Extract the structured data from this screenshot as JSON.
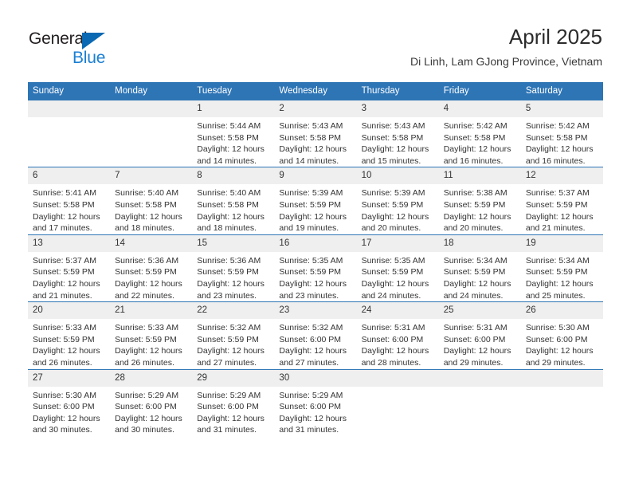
{
  "logo": {
    "word1": "General",
    "word2": "Blue",
    "triangle_color": "#0a69b2",
    "blue_text_color": "#1a7fd4"
  },
  "header": {
    "title": "April 2025",
    "subtitle": "Di Linh, Lam GJong Province, Vietnam"
  },
  "theme": {
    "header_blue": "#2e75b6",
    "daynum_bg": "#efefef",
    "text": "#333333"
  },
  "weekday_headers": [
    "Sunday",
    "Monday",
    "Tuesday",
    "Wednesday",
    "Thursday",
    "Friday",
    "Saturday"
  ],
  "labels": {
    "sunrise": "Sunrise:",
    "sunset": "Sunset:",
    "daylight": "Daylight:"
  },
  "weeks": [
    [
      {
        "day": "",
        "empty": true
      },
      {
        "day": "",
        "empty": true
      },
      {
        "day": "1",
        "sunrise": "Sunrise: 5:44 AM",
        "sunset": "Sunset: 5:58 PM",
        "daylight": "Daylight: 12 hours and 14 minutes."
      },
      {
        "day": "2",
        "sunrise": "Sunrise: 5:43 AM",
        "sunset": "Sunset: 5:58 PM",
        "daylight": "Daylight: 12 hours and 14 minutes."
      },
      {
        "day": "3",
        "sunrise": "Sunrise: 5:43 AM",
        "sunset": "Sunset: 5:58 PM",
        "daylight": "Daylight: 12 hours and 15 minutes."
      },
      {
        "day": "4",
        "sunrise": "Sunrise: 5:42 AM",
        "sunset": "Sunset: 5:58 PM",
        "daylight": "Daylight: 12 hours and 16 minutes."
      },
      {
        "day": "5",
        "sunrise": "Sunrise: 5:42 AM",
        "sunset": "Sunset: 5:58 PM",
        "daylight": "Daylight: 12 hours and 16 minutes."
      }
    ],
    [
      {
        "day": "6",
        "sunrise": "Sunrise: 5:41 AM",
        "sunset": "Sunset: 5:58 PM",
        "daylight": "Daylight: 12 hours and 17 minutes."
      },
      {
        "day": "7",
        "sunrise": "Sunrise: 5:40 AM",
        "sunset": "Sunset: 5:58 PM",
        "daylight": "Daylight: 12 hours and 18 minutes."
      },
      {
        "day": "8",
        "sunrise": "Sunrise: 5:40 AM",
        "sunset": "Sunset: 5:58 PM",
        "daylight": "Daylight: 12 hours and 18 minutes."
      },
      {
        "day": "9",
        "sunrise": "Sunrise: 5:39 AM",
        "sunset": "Sunset: 5:59 PM",
        "daylight": "Daylight: 12 hours and 19 minutes."
      },
      {
        "day": "10",
        "sunrise": "Sunrise: 5:39 AM",
        "sunset": "Sunset: 5:59 PM",
        "daylight": "Daylight: 12 hours and 20 minutes."
      },
      {
        "day": "11",
        "sunrise": "Sunrise: 5:38 AM",
        "sunset": "Sunset: 5:59 PM",
        "daylight": "Daylight: 12 hours and 20 minutes."
      },
      {
        "day": "12",
        "sunrise": "Sunrise: 5:37 AM",
        "sunset": "Sunset: 5:59 PM",
        "daylight": "Daylight: 12 hours and 21 minutes."
      }
    ],
    [
      {
        "day": "13",
        "sunrise": "Sunrise: 5:37 AM",
        "sunset": "Sunset: 5:59 PM",
        "daylight": "Daylight: 12 hours and 21 minutes."
      },
      {
        "day": "14",
        "sunrise": "Sunrise: 5:36 AM",
        "sunset": "Sunset: 5:59 PM",
        "daylight": "Daylight: 12 hours and 22 minutes."
      },
      {
        "day": "15",
        "sunrise": "Sunrise: 5:36 AM",
        "sunset": "Sunset: 5:59 PM",
        "daylight": "Daylight: 12 hours and 23 minutes."
      },
      {
        "day": "16",
        "sunrise": "Sunrise: 5:35 AM",
        "sunset": "Sunset: 5:59 PM",
        "daylight": "Daylight: 12 hours and 23 minutes."
      },
      {
        "day": "17",
        "sunrise": "Sunrise: 5:35 AM",
        "sunset": "Sunset: 5:59 PM",
        "daylight": "Daylight: 12 hours and 24 minutes."
      },
      {
        "day": "18",
        "sunrise": "Sunrise: 5:34 AM",
        "sunset": "Sunset: 5:59 PM",
        "daylight": "Daylight: 12 hours and 24 minutes."
      },
      {
        "day": "19",
        "sunrise": "Sunrise: 5:34 AM",
        "sunset": "Sunset: 5:59 PM",
        "daylight": "Daylight: 12 hours and 25 minutes."
      }
    ],
    [
      {
        "day": "20",
        "sunrise": "Sunrise: 5:33 AM",
        "sunset": "Sunset: 5:59 PM",
        "daylight": "Daylight: 12 hours and 26 minutes."
      },
      {
        "day": "21",
        "sunrise": "Sunrise: 5:33 AM",
        "sunset": "Sunset: 5:59 PM",
        "daylight": "Daylight: 12 hours and 26 minutes."
      },
      {
        "day": "22",
        "sunrise": "Sunrise: 5:32 AM",
        "sunset": "Sunset: 5:59 PM",
        "daylight": "Daylight: 12 hours and 27 minutes."
      },
      {
        "day": "23",
        "sunrise": "Sunrise: 5:32 AM",
        "sunset": "Sunset: 6:00 PM",
        "daylight": "Daylight: 12 hours and 27 minutes."
      },
      {
        "day": "24",
        "sunrise": "Sunrise: 5:31 AM",
        "sunset": "Sunset: 6:00 PM",
        "daylight": "Daylight: 12 hours and 28 minutes."
      },
      {
        "day": "25",
        "sunrise": "Sunrise: 5:31 AM",
        "sunset": "Sunset: 6:00 PM",
        "daylight": "Daylight: 12 hours and 29 minutes."
      },
      {
        "day": "26",
        "sunrise": "Sunrise: 5:30 AM",
        "sunset": "Sunset: 6:00 PM",
        "daylight": "Daylight: 12 hours and 29 minutes."
      }
    ],
    [
      {
        "day": "27",
        "sunrise": "Sunrise: 5:30 AM",
        "sunset": "Sunset: 6:00 PM",
        "daylight": "Daylight: 12 hours and 30 minutes."
      },
      {
        "day": "28",
        "sunrise": "Sunrise: 5:29 AM",
        "sunset": "Sunset: 6:00 PM",
        "daylight": "Daylight: 12 hours and 30 minutes."
      },
      {
        "day": "29",
        "sunrise": "Sunrise: 5:29 AM",
        "sunset": "Sunset: 6:00 PM",
        "daylight": "Daylight: 12 hours and 31 minutes."
      },
      {
        "day": "30",
        "sunrise": "Sunrise: 5:29 AM",
        "sunset": "Sunset: 6:00 PM",
        "daylight": "Daylight: 12 hours and 31 minutes."
      },
      {
        "day": "",
        "empty": true
      },
      {
        "day": "",
        "empty": true
      },
      {
        "day": "",
        "empty": true
      }
    ]
  ]
}
